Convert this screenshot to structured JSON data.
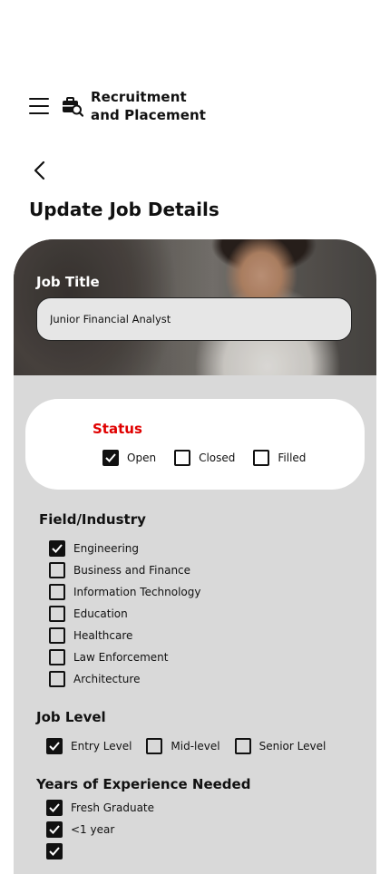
{
  "header": {
    "title_line1": "Recruitment",
    "title_line2": "and Placement"
  },
  "page": {
    "title": "Update Job Details"
  },
  "job_title": {
    "label": "Job Title",
    "value": "Junior Financial Analyst"
  },
  "status": {
    "label": "Status",
    "options": [
      {
        "label": "Open",
        "checked": true
      },
      {
        "label": "Closed",
        "checked": false
      },
      {
        "label": "Filled",
        "checked": false
      }
    ]
  },
  "field_industry": {
    "label": "Field/Industry",
    "options": [
      {
        "label": "Engineering",
        "checked": true
      },
      {
        "label": "Business and Finance",
        "checked": false
      },
      {
        "label": "Information Technology",
        "checked": false
      },
      {
        "label": "Education",
        "checked": false
      },
      {
        "label": "Healthcare",
        "checked": false
      },
      {
        "label": "Law Enforcement",
        "checked": false
      },
      {
        "label": "Architecture",
        "checked": false
      }
    ]
  },
  "job_level": {
    "label": "Job Level",
    "options": [
      {
        "label": "Entry Level",
        "checked": true
      },
      {
        "label": "Mid-level",
        "checked": false
      },
      {
        "label": "Senior Level",
        "checked": false
      }
    ]
  },
  "experience": {
    "label": "Years of Experience Needed",
    "options": [
      {
        "label": "Fresh Graduate",
        "checked": true
      },
      {
        "label": "<1 year",
        "checked": true
      },
      {
        "label": "",
        "checked": true
      }
    ]
  },
  "colors": {
    "status_label": "#e00000",
    "card_background": "#d9d9d9",
    "checkbox": "#111111"
  },
  "icons": {
    "menu": "hamburger-menu-icon",
    "logo": "briefcase-search-icon",
    "back": "chevron-left-icon",
    "check": "checkmark-icon"
  }
}
